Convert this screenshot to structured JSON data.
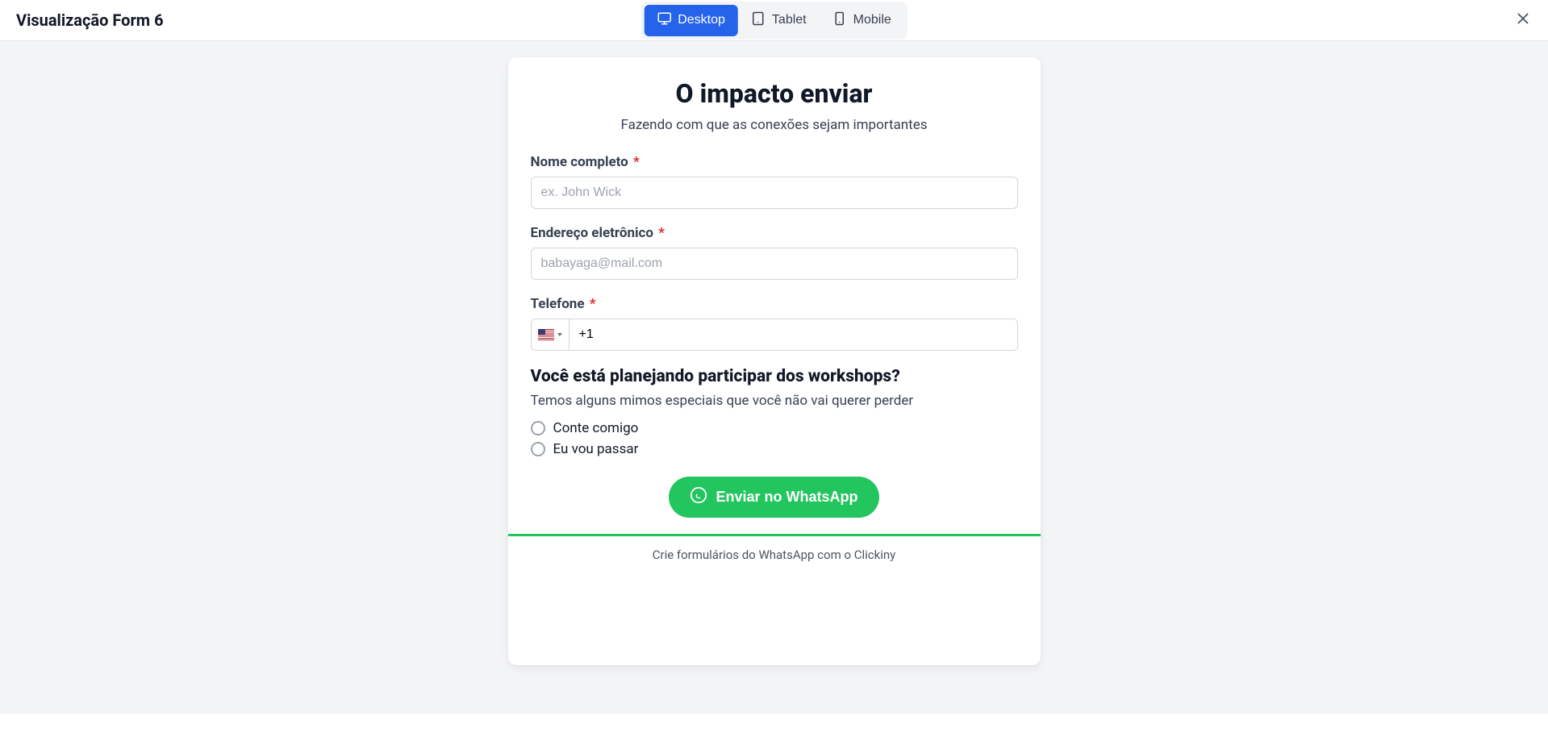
{
  "header": {
    "title": "Visualização Form 6",
    "tabs": {
      "desktop": "Desktop",
      "tablet": "Tablet",
      "mobile": "Mobile"
    }
  },
  "form": {
    "title": "O impacto enviar",
    "subtitle": "Fazendo com que as conexões sejam importantes",
    "fields": {
      "name": {
        "label": "Nome completo",
        "placeholder": "ex. John Wick"
      },
      "email": {
        "label": "Endereço eletrônico",
        "placeholder": "babayaga@mail.com"
      },
      "phone": {
        "label": "Telefone",
        "dial": "+1"
      }
    },
    "question": {
      "title": "Você está planejando participar dos workshops?",
      "desc": "Temos alguns mimos especiais que você não vai querer perder",
      "options": [
        "Conte comigo",
        "Eu vou passar"
      ]
    },
    "submit_label": "Enviar no WhatsApp",
    "footer": "Crie formulários do WhatsApp com o Clickiny"
  },
  "required_marker": "*"
}
